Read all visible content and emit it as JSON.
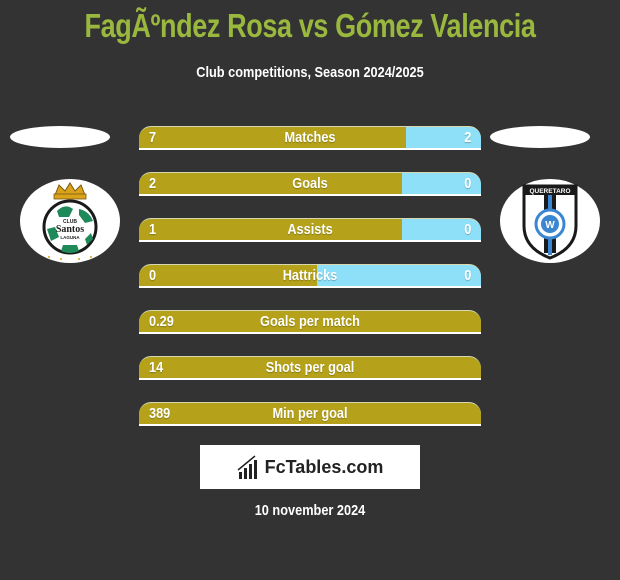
{
  "header": {
    "title": "FagÃºndez Rosa vs Gómez Valencia",
    "subtitle": "Club competitions, Season 2024/2025"
  },
  "teams": {
    "left": {
      "name": "Santos Laguna",
      "logo_icon": "santos-laguna-crest-icon",
      "crest_text": [
        "CLUB",
        "Santos",
        "LAGUNA"
      ]
    },
    "right": {
      "name": "Querétaro",
      "logo_icon": "queretaro-crest-icon",
      "crest_text": "QUERETARO"
    }
  },
  "colors": {
    "left_bar": "#b5a21a",
    "right_bar": "#8ee0f8",
    "title": "#9ab83e",
    "background": "#333333"
  },
  "stats": [
    {
      "label": "Matches",
      "left": "7",
      "right": "2",
      "left_share": 0.78
    },
    {
      "label": "Goals",
      "left": "2",
      "right": "0",
      "left_share": 0.77
    },
    {
      "label": "Assists",
      "left": "1",
      "right": "0",
      "left_share": 0.77
    },
    {
      "label": "Hattricks",
      "left": "0",
      "right": "0",
      "left_share": 0.52
    },
    {
      "label": "Goals per match",
      "left": "0.29",
      "right": "",
      "left_share": 1.0
    },
    {
      "label": "Shots per goal",
      "left": "14",
      "right": "",
      "left_share": 1.0
    },
    {
      "label": "Min per goal",
      "left": "389",
      "right": "",
      "left_share": 1.0
    }
  ],
  "brand": {
    "name": "FcTables.com",
    "icon": "bar-chart-icon"
  },
  "footer": {
    "date": "10 november 2024"
  }
}
